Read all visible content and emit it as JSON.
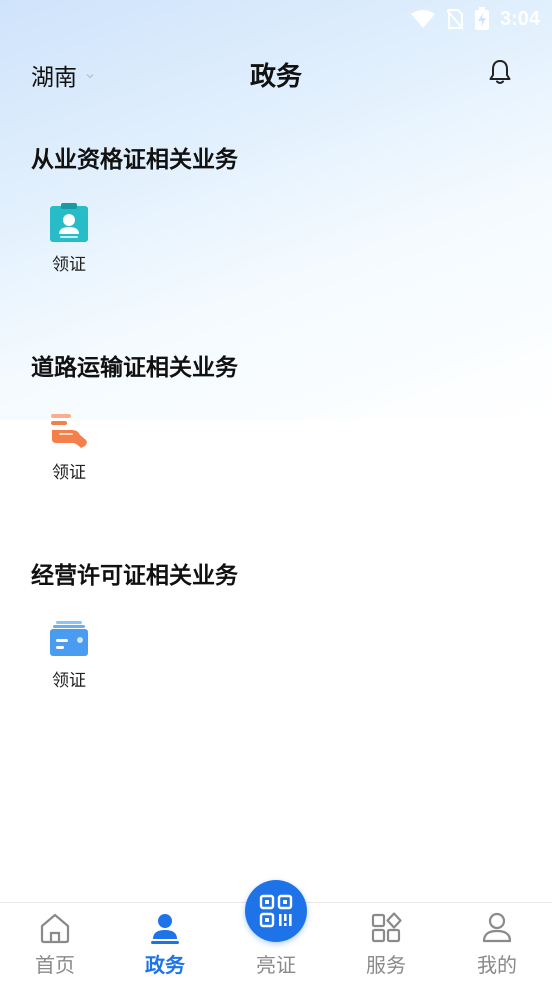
{
  "status_bar": {
    "time": "3:04"
  },
  "header": {
    "region": "湖南",
    "title": "政务"
  },
  "sections": [
    {
      "title": "从业资格证相关业务",
      "tiles": [
        {
          "label": "领证",
          "icon": "id-card-icon"
        }
      ]
    },
    {
      "title": "道路运输证相关业务",
      "tiles": [
        {
          "label": "领证",
          "icon": "hand-document-icon"
        }
      ]
    },
    {
      "title": "经营许可证相关业务",
      "tiles": [
        {
          "label": "领证",
          "icon": "card-stack-icon"
        }
      ]
    }
  ],
  "tabbar": {
    "items": [
      {
        "label": "首页",
        "icon": "home-icon"
      },
      {
        "label": "政务",
        "icon": "person-icon",
        "active": true
      },
      {
        "label": "亮证",
        "icon": "qr-code-icon"
      },
      {
        "label": "服务",
        "icon": "grid-icon"
      },
      {
        "label": "我的",
        "icon": "user-icon"
      }
    ]
  },
  "colors": {
    "accent": "#1f73e8",
    "inactive": "#8a8a8a",
    "teal": "#27bcc8",
    "orange": "#f47f4b",
    "blue_card": "#4a9cf0"
  }
}
